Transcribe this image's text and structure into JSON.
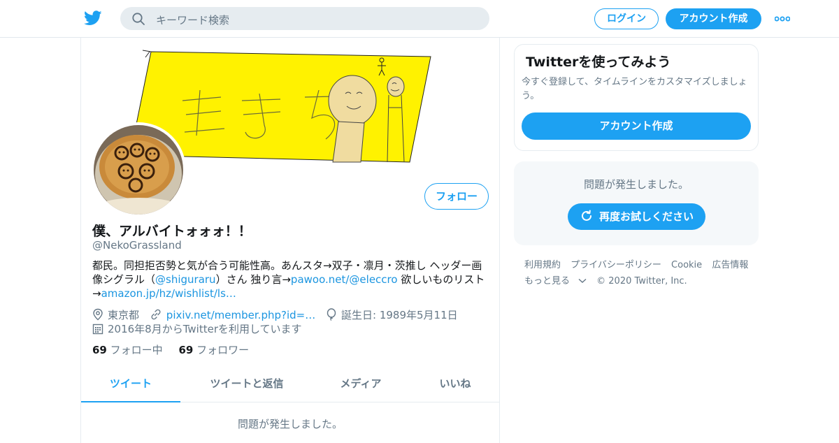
{
  "topbar": {
    "search_placeholder": "キーワード検索",
    "login_label": "ログイン",
    "signup_label": "アカウント作成",
    "logo_icon": "twitter-bird-icon",
    "more_icon": "more-dots-icon"
  },
  "profile": {
    "follow_label": "フォロー",
    "display_name": "僕、アルバイトォォォ！！",
    "handle": "@NekoGrassland",
    "bio": {
      "part1": "都民。同担拒否勢と気が合う可能性高。あんスタ→双子・凛月・茨推し ヘッダー画像シグラル（",
      "link1": "@shiguraru",
      "part2": "）さん 独り言→",
      "link2": "pawoo.net/@eleccro",
      "part3": " 欲しいものリスト→",
      "link3": "amazon.jp/hz/wishlist/ls…"
    },
    "location": "東京都",
    "website": "pixiv.net/member.php?id=…",
    "birthday": "誕生日: 1989年5月11日",
    "joined": "2016年8月からTwitterを利用しています",
    "following_count": "69",
    "following_label": "フォロー中",
    "followers_count": "69",
    "followers_label": "フォロワー",
    "header_image_text": "生きち"
  },
  "tabs": [
    {
      "label": "ツイート",
      "active": true
    },
    {
      "label": "ツイートと返信",
      "active": false
    },
    {
      "label": "メディア",
      "active": false
    },
    {
      "label": "いいね",
      "active": false
    }
  ],
  "main_error": "問題が発生しました。",
  "signup_card": {
    "title": "Twitterを使ってみよう",
    "description": "今すぐ登録して、タイムラインをカスタマイズしましょう。",
    "button_label": "アカウント作成"
  },
  "error_card": {
    "message": "問題が発生しました。",
    "retry_label": "再度お試しください"
  },
  "footer": {
    "links": [
      "利用規約",
      "プライバシーポリシー",
      "Cookie",
      "広告情報"
    ],
    "more_label": "もっと見る",
    "copyright": "© 2020 Twitter, Inc."
  },
  "colors": {
    "accent": "#1da1f2",
    "link": "#1b95e0",
    "muted": "#657786",
    "banner_yellow": "#fff200"
  }
}
